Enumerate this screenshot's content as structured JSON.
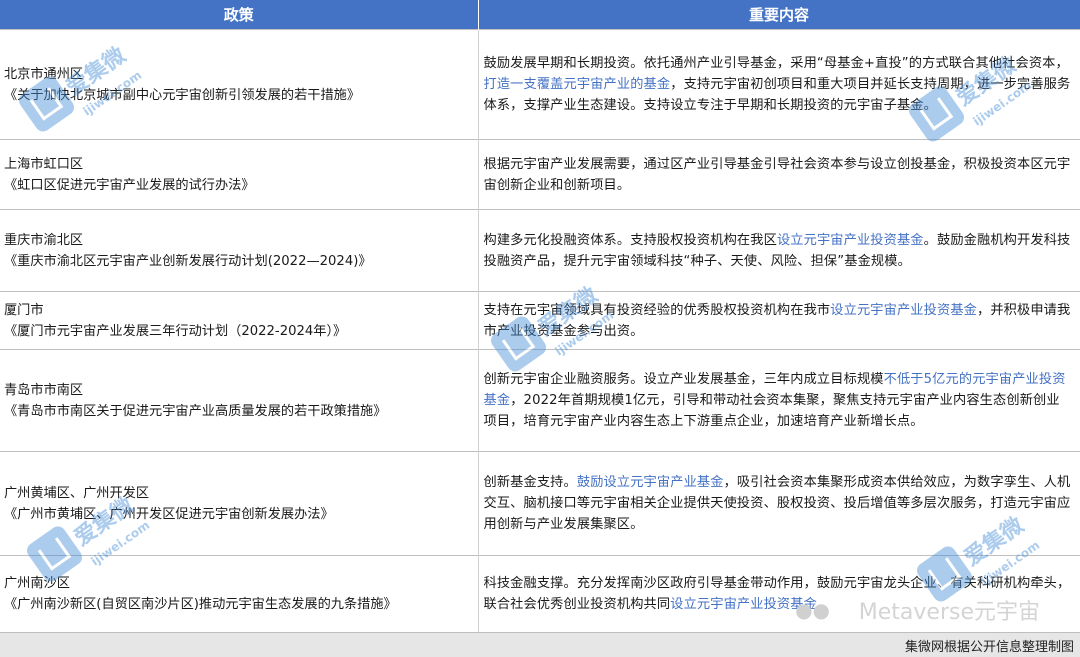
{
  "header": {
    "col_policy": "政策",
    "col_content": "重要内容"
  },
  "rows": [
    {
      "region": "北京市通州区",
      "policy": "《关于加快北京城市副中心元宇宙创新引领发展的若干措施》",
      "content": [
        {
          "t": "鼓励发展早期和长期投资。依托通州产业引导基金，采用“母基金+直投”的方式联合其他社会资本，"
        },
        {
          "t": "打造一支覆盖元宇宙产业的基金",
          "hl": true
        },
        {
          "t": "，支持元宇宙初创项目和重大项目并延长支持周期，进一步完善服务体系，支撑产业生态建设。支持设立专注于早期和长期投资的元宇宙子基金。"
        }
      ]
    },
    {
      "region": "上海市虹口区",
      "policy": "《虹口区促进元宇宙产业发展的试行办法》",
      "content": [
        {
          "t": "根据元宇宙产业发展需要，通过区产业引导基金引导社会资本参与设立创投基金，积极投资本区元宇宙创新企业和创新项目。"
        }
      ]
    },
    {
      "region": "重庆市渝北区",
      "policy": "《重庆市渝北区元宇宙产业创新发展行动计划(2022—2024)》",
      "content": [
        {
          "t": "构建多元化投融资体系。支持股权投资机构在我区"
        },
        {
          "t": "设立元宇宙产业投资基金",
          "hl": true
        },
        {
          "t": "。鼓励金融机构开发科技投融资产品，提升元宇宙领域科技“种子、天使、风险、担保”基金规模。"
        }
      ]
    },
    {
      "region": "厦门市",
      "policy": "《厦门市元宇宙产业发展三年行动计划（2022-2024年）》",
      "content": [
        {
          "t": "支持在元宇宙领域具有投资经验的优秀股权投资机构在我市"
        },
        {
          "t": "设立元宇宙产业投资基金",
          "hl": true
        },
        {
          "t": "，并积极申请我市产业投资基金参与出资。"
        }
      ]
    },
    {
      "region": "青岛市市南区",
      "policy": "《青岛市市南区关于促进元宇宙产业高质量发展的若干政策措施》",
      "content": [
        {
          "t": "创新元宇宙企业融资服务。设立产业发展基金，三年内成立目标规模"
        },
        {
          "t": "不低于5亿元的元宇宙产业投资基金",
          "hl": true
        },
        {
          "t": "，2022年首期规模1亿元，引导和带动社会资本集聚，聚焦支持元宇宙产业内容生态创新创业项目，培育元宇宙产业内容生态上下游重点企业，加速培育产业新增长点。"
        }
      ]
    },
    {
      "region": "广州黄埔区、广州开发区",
      "policy": "《广州市黄埔区、广州开发区促进元宇宙创新发展办法》",
      "content": [
        {
          "t": "创新基金支持。"
        },
        {
          "t": "鼓励设立元宇宙产业基金",
          "hl": true
        },
        {
          "t": "，吸引社会资本集聚形成资本供给效应，为数字孪生、人机交互、脑机接口等元宇宙相关企业提供天使投资、股权投资、投后增值等多层次服务，打造元宇宙应用创新与产业发展集聚区。"
        }
      ]
    },
    {
      "region": "广州南沙区",
      "policy": "《广州南沙新区(自贸区南沙片区)推动元宇宙生态发展的九条措施》",
      "content": [
        {
          "t": "科技金融支撑。充分发挥南沙区政府引导基金带动作用，鼓励元宇宙龙头企业、有关科研机构牵头，联合社会优秀创业投资机构共同"
        },
        {
          "t": "设立元宇宙产业投资基金",
          "hl": true
        },
        {
          "t": "。"
        }
      ]
    }
  ],
  "footer": {
    "source": "集微网根据公开信息整理制图"
  },
  "watermark": {
    "name": "爱集微",
    "url": "ijiwei.com"
  },
  "brand": {
    "label": "Metaverse元宇宙",
    "icon": "wechat-icon"
  }
}
